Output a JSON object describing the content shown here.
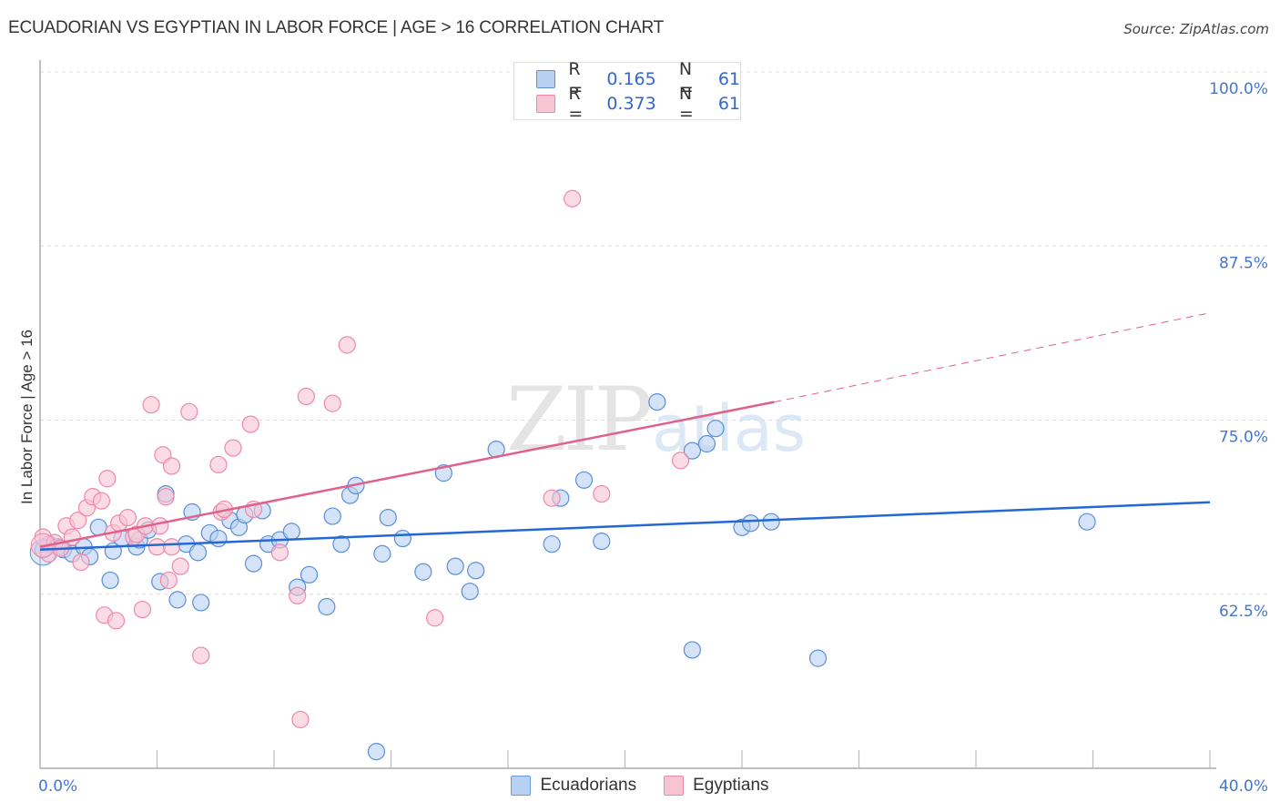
{
  "title": "ECUADORIAN VS EGYPTIAN IN LABOR FORCE | AGE > 16 CORRELATION CHART",
  "source": "Source: ZipAtlas.com",
  "watermark": {
    "zip": "ZIP",
    "atlas": "atlas"
  },
  "legend": {
    "rows": [
      {
        "r_label": "R =",
        "r_value": "0.165",
        "n_label": "N =",
        "n_value": "61",
        "series": "Ecuadorians"
      },
      {
        "r_label": "R =",
        "r_value": "0.373",
        "n_label": "N =",
        "n_value": "61",
        "series": "Egyptians"
      }
    ]
  },
  "bottom_legend": [
    {
      "label": "Ecuadorians",
      "color": "#6699dd"
    },
    {
      "label": "Egyptians",
      "color": "#ee88aa"
    }
  ],
  "colors": {
    "blue_fill": "#b8d0f2",
    "blue_stroke": "#5b8ed8",
    "blue_line": "#2468d6",
    "pink_fill": "#f8c4d4",
    "pink_stroke": "#ee88aa",
    "pink_line": "#e0608a",
    "axis_label": "#4477cc",
    "grid": "#dddddd"
  },
  "chart_data": {
    "type": "scatter",
    "title": "ECUADORIAN VS EGYPTIAN IN LABOR FORCE | AGE > 16 CORRELATION CHART",
    "xlabel": "",
    "ylabel": "In Labor Force | Age > 16",
    "xlim": [
      0,
      40
    ],
    "ylim": [
      50,
      100
    ],
    "x_tick_labels": [
      "0.0%",
      "40.0%"
    ],
    "x_minor_ticks": [
      0,
      4,
      8,
      12,
      16,
      20,
      24,
      28,
      32,
      36,
      40
    ],
    "y_ticks": [
      100,
      87.5,
      75,
      62.5
    ],
    "y_tick_labels": [
      "100.0%",
      "87.5%",
      "75.0%",
      "62.5%"
    ],
    "grid": true,
    "legend_placement": "top-center",
    "series": [
      {
        "name": "Ecuadorians",
        "r": 0.165,
        "n": 61,
        "trend": {
          "x": [
            0,
            40
          ],
          "y": [
            65.7,
            69.1
          ],
          "style": "solid"
        },
        "points": [
          [
            0.1,
            65.7
          ],
          [
            0.3,
            66.1
          ],
          [
            0.6,
            65.9
          ],
          [
            0.8,
            65.7
          ],
          [
            1.1,
            65.4
          ],
          [
            1.5,
            65.9
          ],
          [
            1.7,
            65.2
          ],
          [
            2.0,
            67.3
          ],
          [
            2.4,
            63.5
          ],
          [
            2.5,
            65.6
          ],
          [
            2.8,
            66.5
          ],
          [
            3.3,
            65.9
          ],
          [
            3.4,
            66.4
          ],
          [
            3.7,
            67.1
          ],
          [
            4.1,
            63.4
          ],
          [
            4.3,
            69.7
          ],
          [
            4.7,
            62.1
          ],
          [
            5.0,
            66.1
          ],
          [
            5.2,
            68.4
          ],
          [
            5.4,
            65.5
          ],
          [
            5.5,
            61.9
          ],
          [
            5.8,
            66.9
          ],
          [
            6.1,
            66.5
          ],
          [
            6.5,
            67.8
          ],
          [
            6.8,
            67.3
          ],
          [
            7.0,
            68.2
          ],
          [
            7.6,
            68.5
          ],
          [
            7.3,
            64.7
          ],
          [
            7.8,
            66.1
          ],
          [
            8.2,
            66.4
          ],
          [
            8.6,
            67.0
          ],
          [
            8.8,
            63.0
          ],
          [
            9.2,
            63.9
          ],
          [
            9.8,
            61.6
          ],
          [
            10.0,
            68.1
          ],
          [
            10.3,
            66.1
          ],
          [
            10.6,
            69.6
          ],
          [
            10.8,
            70.3
          ],
          [
            11.5,
            51.2
          ],
          [
            11.7,
            65.4
          ],
          [
            11.9,
            68.0
          ],
          [
            12.4,
            66.5
          ],
          [
            13.1,
            64.1
          ],
          [
            13.8,
            71.2
          ],
          [
            14.2,
            64.5
          ],
          [
            14.7,
            62.7
          ],
          [
            14.9,
            64.2
          ],
          [
            15.6,
            72.9
          ],
          [
            17.5,
            66.1
          ],
          [
            17.8,
            69.4
          ],
          [
            18.6,
            70.7
          ],
          [
            19.2,
            66.3
          ],
          [
            21.1,
            76.3
          ],
          [
            22.3,
            58.5
          ],
          [
            22.3,
            72.8
          ],
          [
            22.8,
            73.3
          ],
          [
            23.1,
            74.4
          ],
          [
            24.0,
            67.3
          ],
          [
            24.3,
            67.6
          ],
          [
            25.0,
            67.7
          ],
          [
            26.6,
            57.9
          ],
          [
            35.8,
            67.7
          ]
        ]
      },
      {
        "name": "Egyptians",
        "r": 0.373,
        "n": 61,
        "trend": {
          "x": [
            0,
            25.1
          ],
          "y": [
            65.9,
            76.3
          ],
          "style": "solid",
          "extension": {
            "x": [
              25.1,
              40
            ],
            "y": [
              76.3,
              82.7
            ],
            "style": "dashed"
          }
        },
        "points": [
          [
            0.1,
            66.6
          ],
          [
            0.3,
            65.4
          ],
          [
            0.5,
            66.2
          ],
          [
            0.7,
            65.8
          ],
          [
            0.9,
            67.4
          ],
          [
            1.1,
            66.6
          ],
          [
            1.3,
            67.8
          ],
          [
            1.4,
            64.8
          ],
          [
            1.6,
            68.7
          ],
          [
            1.8,
            69.5
          ],
          [
            2.1,
            69.2
          ],
          [
            2.3,
            70.8
          ],
          [
            2.2,
            61.0
          ],
          [
            2.5,
            66.9
          ],
          [
            2.6,
            60.6
          ],
          [
            2.7,
            67.6
          ],
          [
            3.0,
            68.0
          ],
          [
            3.2,
            66.6
          ],
          [
            3.3,
            66.8
          ],
          [
            3.5,
            61.4
          ],
          [
            3.6,
            67.4
          ],
          [
            3.8,
            76.1
          ],
          [
            4.0,
            65.9
          ],
          [
            4.1,
            67.4
          ],
          [
            4.2,
            72.5
          ],
          [
            4.3,
            69.5
          ],
          [
            4.4,
            63.5
          ],
          [
            4.5,
            65.9
          ],
          [
            4.5,
            71.7
          ],
          [
            4.8,
            64.5
          ],
          [
            5.1,
            75.6
          ],
          [
            5.5,
            58.1
          ],
          [
            6.1,
            71.8
          ],
          [
            6.2,
            68.4
          ],
          [
            6.3,
            68.6
          ],
          [
            6.6,
            73.0
          ],
          [
            7.2,
            74.7
          ],
          [
            7.3,
            68.6
          ],
          [
            8.2,
            65.5
          ],
          [
            8.8,
            62.4
          ],
          [
            8.9,
            53.5
          ],
          [
            9.1,
            76.7
          ],
          [
            10.0,
            76.2
          ],
          [
            10.5,
            80.4
          ],
          [
            13.5,
            60.8
          ],
          [
            17.5,
            69.4
          ],
          [
            18.2,
            90.9
          ],
          [
            19.2,
            69.7
          ],
          [
            21.9,
            72.1
          ]
        ]
      }
    ]
  }
}
